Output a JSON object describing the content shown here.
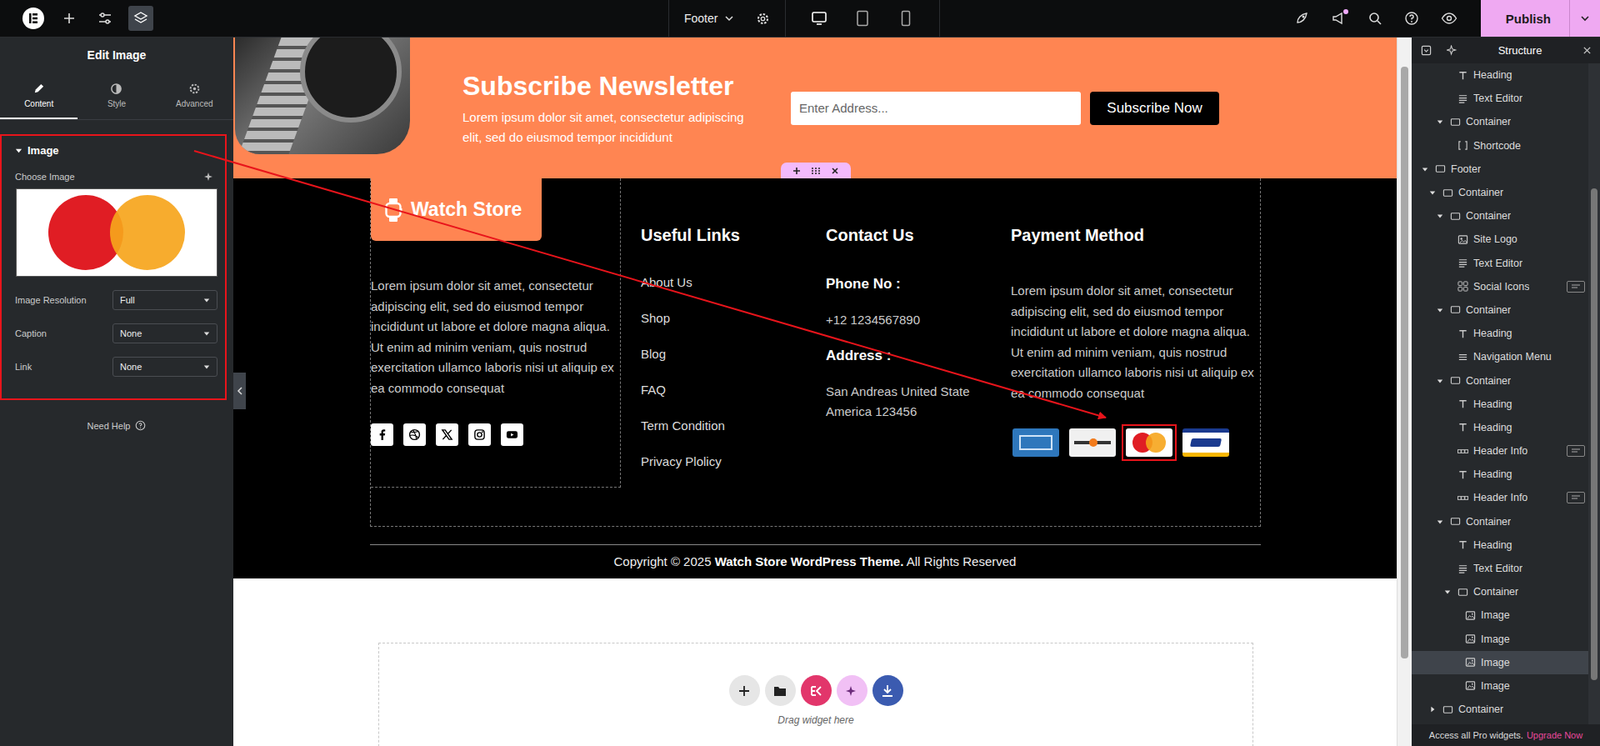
{
  "topbar": {
    "page_title": "Footer",
    "publish": "Publish",
    "notification": true,
    "tools": [
      {
        "kind": "elementor",
        "selected": false
      },
      {
        "kind": "add",
        "selected": false
      },
      {
        "kind": "settings",
        "selected": false
      },
      {
        "kind": "structure",
        "selected": true
      }
    ],
    "devices": [
      {
        "kind": "desktop",
        "selected": true
      },
      {
        "kind": "tablet",
        "selected": false
      },
      {
        "kind": "mobile",
        "selected": false
      }
    ]
  },
  "panel": {
    "title": "Edit Image",
    "tabs": [
      {
        "label": "Content",
        "kind": "pencil",
        "selected": true
      },
      {
        "label": "Style",
        "kind": "contrast",
        "selected": false
      },
      {
        "label": "Advanced",
        "kind": "gear",
        "selected": false
      }
    ],
    "section": {
      "title": "Image",
      "expanded": true,
      "selected": true,
      "choose_label": "Choose Image",
      "fields": [
        {
          "label": "Image Resolution",
          "value": "Full"
        },
        {
          "label": "Caption",
          "value": "None"
        },
        {
          "label": "Link",
          "value": "None"
        }
      ]
    },
    "help": "Need Help"
  },
  "newsletter": {
    "title": "Subscribe Newsletter",
    "text": "Lorem ipsum dolor sit amet, consectetur adipiscing elit, sed do eiusmod tempor incididunt",
    "placeholder": "Enter Address...",
    "button": "Subscribe Now"
  },
  "footer": {
    "brand": "Watch Store",
    "about": "Lorem ipsum dolor sit amet, consectetur adipiscing elit, sed do eiusmod tempor incididunt ut labore et dolore magna aliqua. Ut enim ad minim veniam, quis nostrud exercitation ullamco laboris nisi ut aliquip ex ea commodo consequat",
    "socials": [
      {
        "kind": "facebook"
      },
      {
        "kind": "dribbble"
      },
      {
        "kind": "x"
      },
      {
        "kind": "instagram"
      },
      {
        "kind": "youtube"
      }
    ],
    "links_title": "Useful Links",
    "links": [
      "About Us",
      "Shop",
      "Blog",
      "FAQ",
      "Term Condition",
      "Privacy Plolicy"
    ],
    "contact_title": "Contact Us",
    "contacts": [
      {
        "label": "Phone No :",
        "value": "+12 1234567890"
      },
      {
        "label": "Address :",
        "value": "San Andreas United State America 123456"
      }
    ],
    "payment_title": "Payment Method",
    "payment_text": "Lorem ipsum dolor sit amet, consectetur adipiscing elit, sed do eiusmod tempor incididunt ut labore et dolore magna aliqua. Ut enim ad minim veniam, quis nostrud exercitation ullamco laboris nisi ut aliquip ex ea commodo consequat",
    "cards": [
      {
        "kind": "amex",
        "selected": false
      },
      {
        "kind": "discover",
        "selected": false
      },
      {
        "kind": "mastercard",
        "selected": true
      },
      {
        "kind": "visa",
        "selected": false
      }
    ],
    "copyright": {
      "prefix": "Copyright © 2025 ",
      "brand": "Watch Store WordPress Theme.",
      "suffix": " All Rights Reserved"
    }
  },
  "dropzone": {
    "hint": "Drag widget here",
    "buttons": [
      {
        "kind": "add",
        "color": "#e6e6e6"
      },
      {
        "kind": "folder",
        "color": "#e6e6e6"
      },
      {
        "kind": "elementskit",
        "color": "#e2366b"
      },
      {
        "kind": "ai",
        "color": "#f1c0f5"
      },
      {
        "kind": "download",
        "color": "#3b5bb0"
      }
    ]
  },
  "structure": {
    "title": "Structure",
    "items": [
      {
        "label": "Heading",
        "depth": 3,
        "kind": "heading",
        "expanded": false,
        "selected": false,
        "pro": false
      },
      {
        "label": "Text Editor",
        "depth": 3,
        "kind": "text",
        "expanded": false,
        "selected": false,
        "pro": false
      },
      {
        "label": "Container",
        "depth": 2,
        "kind": "container",
        "expanded": true,
        "selected": false,
        "pro": false
      },
      {
        "label": "Shortcode",
        "depth": 3,
        "kind": "shortcode",
        "expanded": false,
        "selected": false,
        "pro": false
      },
      {
        "label": "Footer",
        "depth": 0,
        "kind": "container",
        "expanded": true,
        "selected": false,
        "pro": false
      },
      {
        "label": "Container",
        "depth": 1,
        "kind": "container",
        "expanded": true,
        "selected": false,
        "pro": false
      },
      {
        "label": "Container",
        "depth": 2,
        "kind": "container",
        "expanded": true,
        "selected": false,
        "pro": false
      },
      {
        "label": "Site Logo",
        "depth": 3,
        "kind": "logo",
        "expanded": false,
        "selected": false,
        "pro": false
      },
      {
        "label": "Text Editor",
        "depth": 3,
        "kind": "text",
        "expanded": false,
        "selected": false,
        "pro": false
      },
      {
        "label": "Social Icons",
        "depth": 3,
        "kind": "social",
        "expanded": false,
        "selected": false,
        "pro": true
      },
      {
        "label": "Container",
        "depth": 2,
        "kind": "container",
        "expanded": true,
        "selected": false,
        "pro": false
      },
      {
        "label": "Heading",
        "depth": 3,
        "kind": "heading",
        "expanded": false,
        "selected": false,
        "pro": false
      },
      {
        "label": "Navigation Menu",
        "depth": 3,
        "kind": "menu",
        "expanded": false,
        "selected": false,
        "pro": false
      },
      {
        "label": "Container",
        "depth": 2,
        "kind": "container",
        "expanded": true,
        "selected": false,
        "pro": false
      },
      {
        "label": "Heading",
        "depth": 3,
        "kind": "heading",
        "expanded": false,
        "selected": false,
        "pro": false
      },
      {
        "label": "Heading",
        "depth": 3,
        "kind": "heading",
        "expanded": false,
        "selected": false,
        "pro": false
      },
      {
        "label": "Header Info",
        "depth": 3,
        "kind": "info",
        "expanded": false,
        "selected": false,
        "pro": true
      },
      {
        "label": "Heading",
        "depth": 3,
        "kind": "heading",
        "expanded": false,
        "selected": false,
        "pro": false
      },
      {
        "label": "Header Info",
        "depth": 3,
        "kind": "info",
        "expanded": false,
        "selected": false,
        "pro": true
      },
      {
        "label": "Container",
        "depth": 2,
        "kind": "container",
        "expanded": true,
        "selected": false,
        "pro": false
      },
      {
        "label": "Heading",
        "depth": 3,
        "kind": "heading",
        "expanded": false,
        "selected": false,
        "pro": false
      },
      {
        "label": "Text Editor",
        "depth": 3,
        "kind": "text",
        "expanded": false,
        "selected": false,
        "pro": false
      },
      {
        "label": "Container",
        "depth": 3,
        "kind": "container",
        "expanded": true,
        "selected": false,
        "pro": false
      },
      {
        "label": "Image",
        "depth": 4,
        "kind": "image",
        "expanded": false,
        "selected": false,
        "pro": false
      },
      {
        "label": "Image",
        "depth": 4,
        "kind": "image",
        "expanded": false,
        "selected": false,
        "pro": false
      },
      {
        "label": "Image",
        "depth": 4,
        "kind": "image",
        "expanded": false,
        "selected": true,
        "pro": false
      },
      {
        "label": "Image",
        "depth": 4,
        "kind": "image",
        "expanded": false,
        "selected": false,
        "pro": false
      },
      {
        "label": "Container",
        "depth": 1,
        "kind": "container",
        "expanded": false,
        "selected": false,
        "pro": false
      }
    ],
    "promo": "Access all Pro widgets.",
    "upgrade": "Upgrade Now"
  },
  "annotation": {
    "arrow": true,
    "color": "#e8141b"
  }
}
